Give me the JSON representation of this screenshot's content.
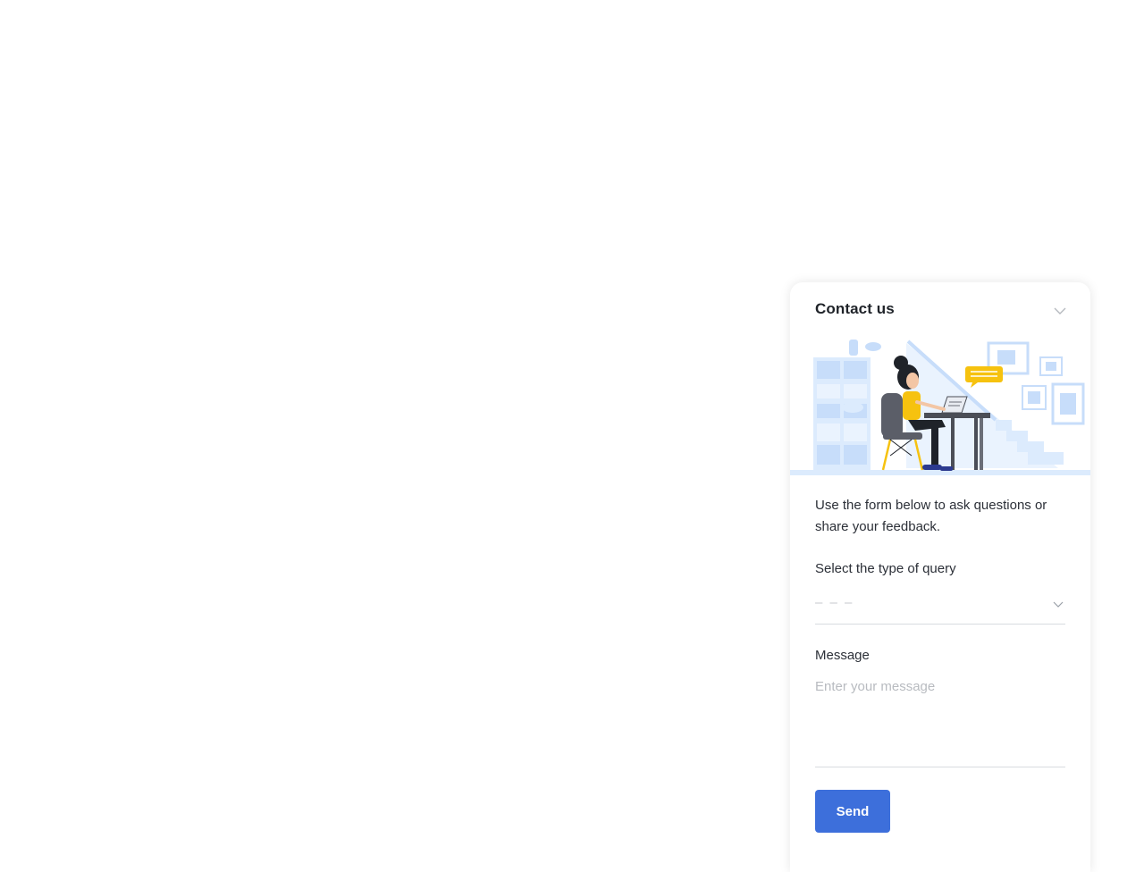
{
  "widget": {
    "title": "Contact us",
    "intro": "Use the form below to ask questions or share your feedback.",
    "query_label": "Select the type of query",
    "query_value": "– – –",
    "message_label": "Message",
    "message_placeholder": "Enter your message",
    "send_label": "Send"
  },
  "icons": {
    "collapse": "chevron-down-icon",
    "select": "chevron-down-icon"
  },
  "colors": {
    "primary": "#3d6fdb",
    "illustration_blue": "#cfe2fb",
    "illustration_yellow": "#f6c20f"
  }
}
